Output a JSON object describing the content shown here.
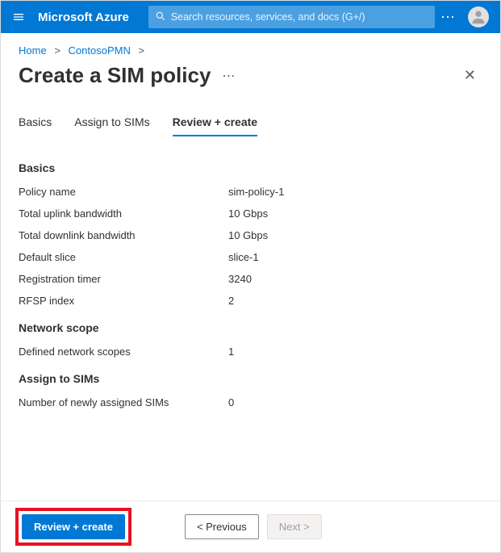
{
  "header": {
    "brand": "Microsoft Azure",
    "search_placeholder": "Search resources, services, and docs (G+/)"
  },
  "breadcrumb": {
    "home": "Home",
    "item": "ContosoPMN"
  },
  "page": {
    "title": "Create a SIM policy"
  },
  "tabs": {
    "basics": "Basics",
    "assign": "Assign to SIMs",
    "review": "Review + create"
  },
  "sections": {
    "basics": {
      "heading": "Basics",
      "rows": {
        "policy_name_label": "Policy name",
        "policy_name_value": "sim-policy-1",
        "uplink_label": "Total uplink bandwidth",
        "uplink_value": "10 Gbps",
        "downlink_label": "Total downlink bandwidth",
        "downlink_value": "10 Gbps",
        "slice_label": "Default slice",
        "slice_value": "slice-1",
        "reg_label": "Registration timer",
        "reg_value": "3240",
        "rfsp_label": "RFSP index",
        "rfsp_value": "2"
      }
    },
    "network": {
      "heading": "Network scope",
      "rows": {
        "scopes_label": "Defined network scopes",
        "scopes_value": "1"
      }
    },
    "assign": {
      "heading": "Assign to SIMs",
      "rows": {
        "count_label": "Number of newly assigned SIMs",
        "count_value": "0"
      }
    }
  },
  "footer": {
    "review_create": "Review + create",
    "previous": "< Previous",
    "next": "Next >"
  }
}
